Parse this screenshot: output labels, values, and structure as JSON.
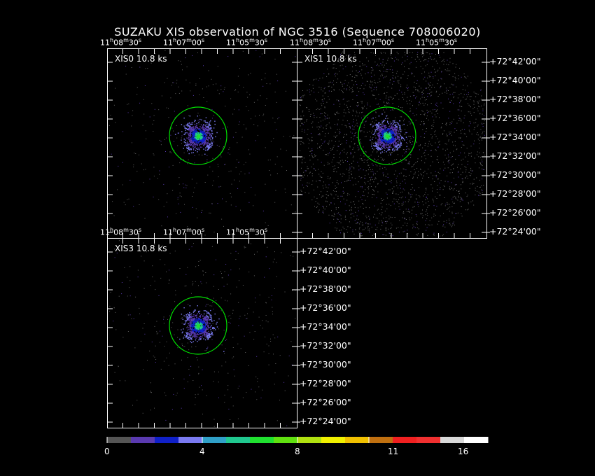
{
  "title": "SUZAKU XIS observation of NGC 3516  (Sequence 708006020)",
  "panels": [
    {
      "label": "XIS0 10.8 ks"
    },
    {
      "label": "XIS1 10.8 ks"
    },
    {
      "label": "XIS3 10.8 ks"
    }
  ],
  "ra_ticks": [
    {
      "h": "11",
      "m": "08",
      "s": "30"
    },
    {
      "h": "11",
      "m": "07",
      "s": "00"
    },
    {
      "h": "11",
      "m": "05",
      "s": "30"
    }
  ],
  "dec_ticks": [
    "+72°42'00\"",
    "+72°40'00\"",
    "+72°38'00\"",
    "+72°36'00\"",
    "+72°34'00\"",
    "+72°32'00\"",
    "+72°30'00\"",
    "+72°28'00\"",
    "+72°26'00\"",
    "+72°24'00\""
  ],
  "colorbar": {
    "colors": [
      "#555555",
      "#5a3ab0",
      "#1020c8",
      "#7a7af0",
      "#30a0c8",
      "#20c890",
      "#20e030",
      "#60e010",
      "#b0e010",
      "#f0f000",
      "#f0c000",
      "#c07010",
      "#f02020",
      "#f03030",
      "#d8d8d8",
      "#ffffff"
    ],
    "tick_labels": [
      "0",
      "4",
      "8",
      "11",
      "16"
    ],
    "tick_values": [
      0,
      4,
      8,
      11,
      16
    ],
    "range": [
      0,
      16
    ]
  },
  "chart_data": {
    "type": "heatmap",
    "title": "SUZAKU XIS observation of NGC 3516  (Sequence 708006020)",
    "panels": [
      "XIS0 10.8 ks",
      "XIS1 10.8 ks",
      "XIS3 10.8 ks"
    ],
    "x_axis_ticks": [
      "11h08m30s",
      "11h07m00s",
      "11h05m30s"
    ],
    "y_axis_ticks": [
      "+72°42'00\"",
      "+72°40'00\"",
      "+72°38'00\"",
      "+72°36'00\"",
      "+72°34'00\"",
      "+72°32'00\"",
      "+72°30'00\"",
      "+72°28'00\"",
      "+72°26'00\"",
      "+72°24'00\""
    ],
    "colorbar_range": [
      0,
      16
    ],
    "colorbar_ticks": [
      0,
      4,
      8,
      11,
      16
    ],
    "source_region": "circle",
    "source_color": "#00e000"
  }
}
